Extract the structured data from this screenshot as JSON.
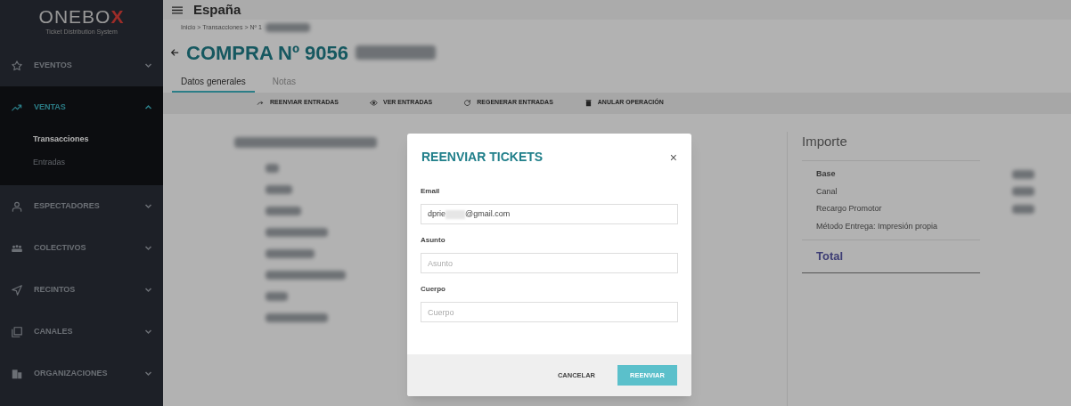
{
  "sidebar": {
    "logo": "ONEBO",
    "logo_accent": "X",
    "tagline": "Ticket Distribution System",
    "items": [
      {
        "kind": "star",
        "label": "EVENTOS",
        "expanded": false,
        "selected": false
      },
      {
        "kind": "trend",
        "label": "VENTAS",
        "expanded": true,
        "selected": true,
        "children": [
          {
            "label": "Transacciones",
            "selected": true
          },
          {
            "label": "Entradas",
            "selected": false
          }
        ]
      },
      {
        "kind": "person",
        "label": "ESPECTADORES",
        "expanded": false,
        "selected": false
      },
      {
        "kind": "group",
        "label": "COLECTIVOS",
        "expanded": false,
        "selected": false
      },
      {
        "kind": "send",
        "label": "RECINTOS",
        "expanded": false,
        "selected": false
      },
      {
        "kind": "copy",
        "label": "CANALES",
        "expanded": false,
        "selected": false
      },
      {
        "kind": "building",
        "label": "ORGANIZACIONES",
        "expanded": false,
        "selected": false
      }
    ]
  },
  "topbar": {
    "title": "España"
  },
  "breadcrumb": "Inicio > Transacciones > Nº 1",
  "page_title": "COMPRA Nº 9056",
  "tabs": [
    {
      "label": "Datos generales",
      "selected": true
    },
    {
      "label": "Notas",
      "selected": false
    }
  ],
  "actions": [
    {
      "kind": "forward",
      "label": "REENVIAR ENTRADAS"
    },
    {
      "kind": "eye",
      "label": "VER ENTRADAS"
    },
    {
      "kind": "refresh",
      "label": "REGENERAR ENTRADAS"
    },
    {
      "kind": "trash",
      "label": "ANULAR OPERACIÓN"
    }
  ],
  "importe": {
    "title": "Importe",
    "rows": [
      {
        "label": "Base",
        "bold": true
      },
      {
        "label": "Canal",
        "bold": false
      },
      {
        "label": "Recargo Promotor",
        "bold": false
      },
      {
        "label": "Método Entrega: Impresión propia",
        "bold": false
      }
    ],
    "total": "Total"
  },
  "modal": {
    "title": "REENVIAR TICKETS",
    "close": "×",
    "fields": [
      {
        "label": "Email",
        "value_start": "dprie",
        "value_end": "@gmail.com",
        "redacted": true
      },
      {
        "label": "Asunto",
        "placeholder": "Asunto"
      },
      {
        "label": "Cuerpo",
        "placeholder": "Cuerpo"
      }
    ],
    "cancel": "CANCELAR",
    "submit": "REENVIAR"
  }
}
